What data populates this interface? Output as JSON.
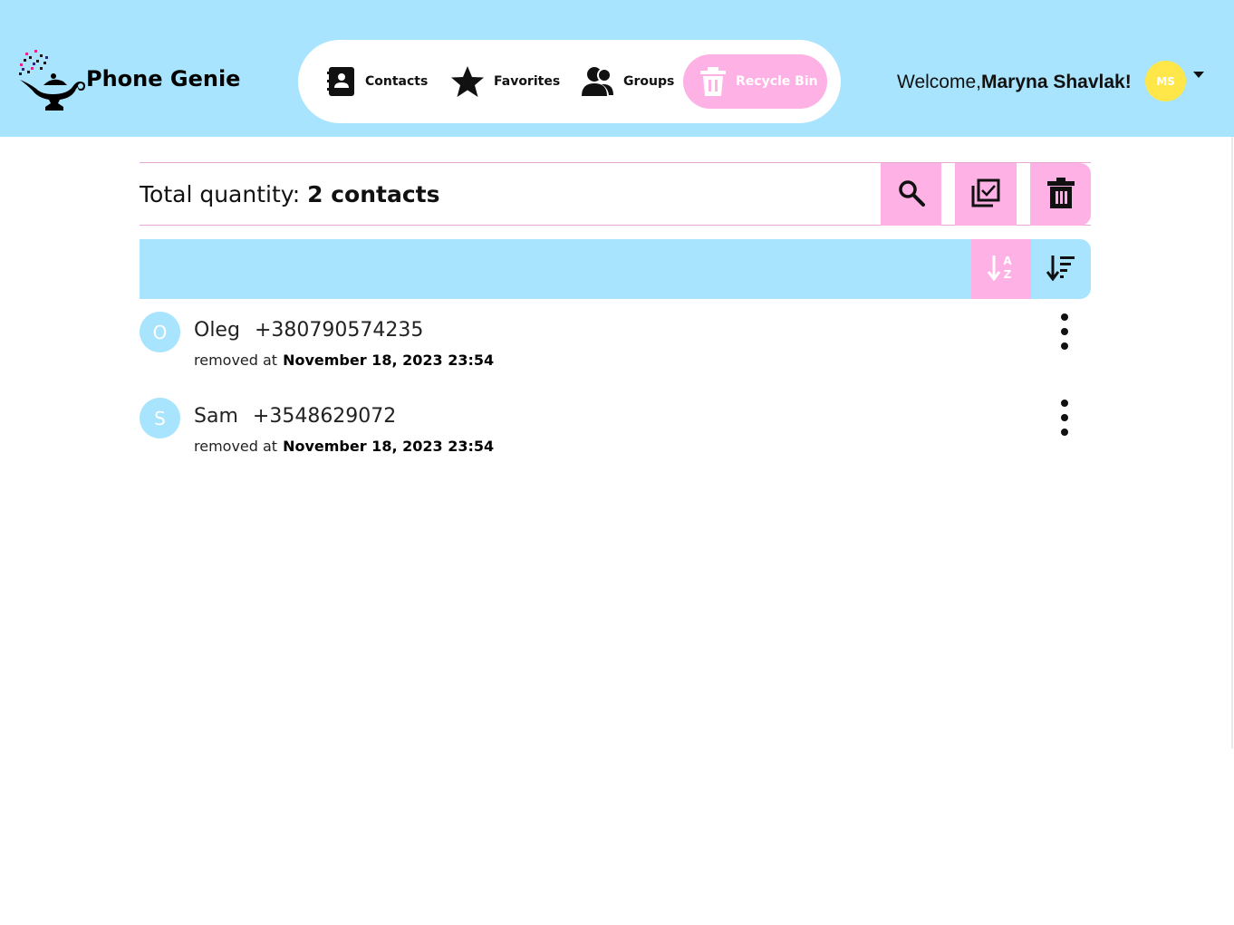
{
  "app": {
    "name": "Phone Genie",
    "logo_icon": "genie-lamp-icon"
  },
  "nav": {
    "items": [
      {
        "label": "Contacts",
        "icon": "contact-book-icon",
        "active": false
      },
      {
        "label": "Favorites",
        "icon": "star-icon",
        "active": false
      },
      {
        "label": "Groups",
        "icon": "users-icon",
        "active": false
      },
      {
        "label": "Recycle Bin",
        "icon": "trash-icon",
        "active": true
      }
    ]
  },
  "user": {
    "welcome_prefix": "Welcome,",
    "name": "Maryna Shavlak!",
    "initials": "MS",
    "avatar_color": "#ffe74a"
  },
  "toolbar": {
    "total_prefix": "Total quantity:",
    "total_count": "2 contacts",
    "buttons": [
      "search-icon",
      "select-all-icon",
      "delete-icon"
    ]
  },
  "sort": {
    "buttons": [
      "sort-alpha-icon",
      "sort-order-icon"
    ]
  },
  "contacts": [
    {
      "initial": "O",
      "name": "Oleg",
      "phone": "+380790574235",
      "removed_label": "removed at",
      "removed_at": "November 18, 2023 23:54"
    },
    {
      "initial": "S",
      "name": "Sam",
      "phone": "+3548629072",
      "removed_label": "removed at",
      "removed_at": "November 18, 2023 23:54"
    }
  ],
  "colors": {
    "header_bg": "#a8e4fd",
    "accent_pink": "#fdb1e4",
    "avatar_blue": "#a8e4fd"
  }
}
